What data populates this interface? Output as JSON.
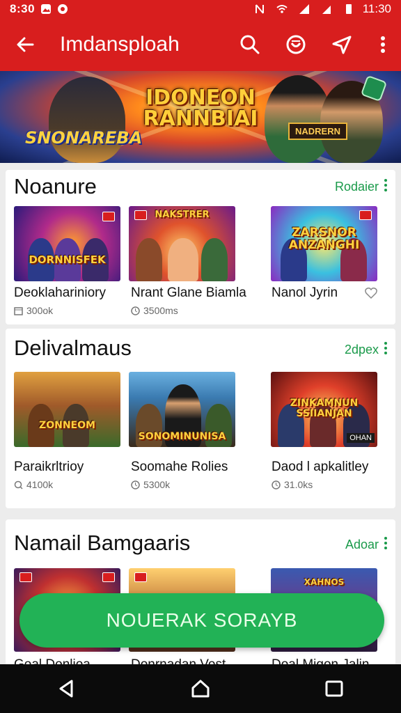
{
  "status_bar": {
    "time_left": "8:30",
    "time_right": "11:30"
  },
  "app_bar": {
    "title": "Imdansploah",
    "icons": [
      "back-arrow-icon",
      "search-icon",
      "emoji-icon",
      "send-icon",
      "more-vert-icon"
    ]
  },
  "banner": {
    "headline": "IDONEON RANNBIAI",
    "left_logo": "SNONAREBA",
    "right_tag": "NADRERN"
  },
  "sections": [
    {
      "title": "Noanure",
      "more_label": "Rodaier",
      "items": [
        {
          "title": "Deoklahariniory",
          "meta": "300ok",
          "thumb_text": "DORNNISFEK"
        },
        {
          "title": "Nrant Glane Biamla",
          "meta": "3500ms",
          "thumb_text": "NAKSTRER"
        },
        {
          "title": "Nanol Jyrin",
          "meta": "",
          "thumb_text": "ZARSNOR ANZANGHI"
        }
      ]
    },
    {
      "title": "Delivalmaus",
      "more_label": "2dpex",
      "items": [
        {
          "title": "Paraikrltrioy",
          "meta": "4100k",
          "thumb_text": "ZONNEOM",
          "tag": ""
        },
        {
          "title": "Soomahe Rolies",
          "meta": "5300k",
          "thumb_text": "SONOMINUNISA"
        },
        {
          "title": "Daod l apkalitley",
          "meta": "31.0ks",
          "thumb_text": "ZINKAMNUN SSIIANJAN",
          "tag": "OHAN"
        }
      ]
    },
    {
      "title": "Namail Bamgaaris",
      "more_label": "Adoar",
      "items": [
        {
          "title": "Goal Donlioa",
          "thumb_text": ""
        },
        {
          "title": "Donrnadan Vost",
          "thumb_text": ""
        },
        {
          "title": "Doal Migon Jalin",
          "thumb_text": "XAHNOS"
        }
      ]
    }
  ],
  "cta": {
    "label": "NOUERAK SORAYB"
  },
  "nav_bar": {
    "icons": [
      "back-triangle-icon",
      "home-icon",
      "recents-icon"
    ]
  },
  "colors": {
    "app_bar_red": "#d81e1e",
    "accent_green": "#1a9a4a",
    "cta_green": "#22b256"
  }
}
